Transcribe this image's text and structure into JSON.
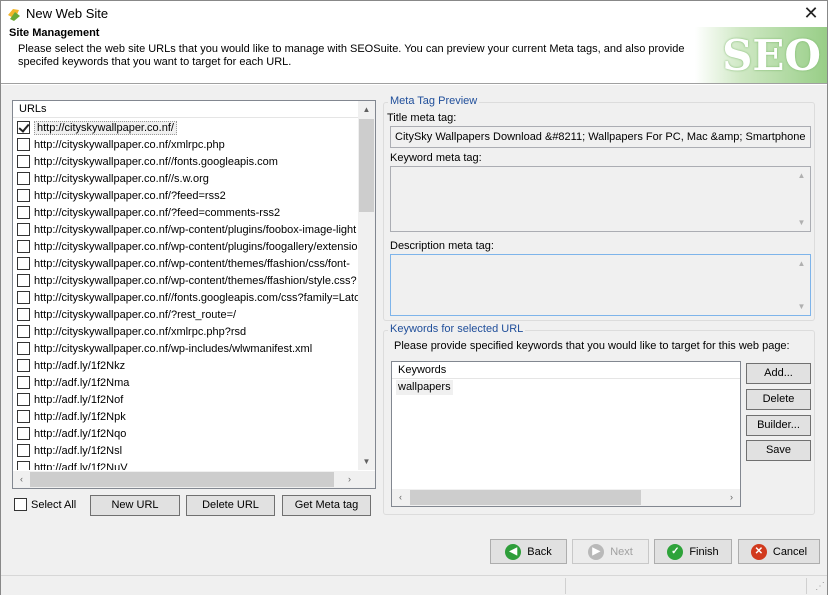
{
  "window": {
    "title": "New Web Site",
    "close_glyph": "✕"
  },
  "header": {
    "title": "Site Management",
    "description": "Please select the web site URLs that you would like to manage with SEOSuite. You can preview your current Meta tags, and also provide specifed keywords that you want to target for each URL.",
    "logo_text": "SEO"
  },
  "urls": {
    "column_header": "URLs",
    "items": [
      {
        "url": "http://cityskywallpaper.co.nf/",
        "checked": true
      },
      {
        "url": "http://cityskywallpaper.co.nf/xmlrpc.php",
        "checked": false
      },
      {
        "url": "http://cityskywallpaper.co.nf//fonts.googleapis.com",
        "checked": false
      },
      {
        "url": "http://cityskywallpaper.co.nf//s.w.org",
        "checked": false
      },
      {
        "url": "http://cityskywallpaper.co.nf/?feed=rss2",
        "checked": false
      },
      {
        "url": "http://cityskywallpaper.co.nf/?feed=comments-rss2",
        "checked": false
      },
      {
        "url": "http://cityskywallpaper.co.nf/wp-content/plugins/foobox-image-light",
        "checked": false
      },
      {
        "url": "http://cityskywallpaper.co.nf/wp-content/plugins/foogallery/extensio",
        "checked": false
      },
      {
        "url": "http://cityskywallpaper.co.nf/wp-content/themes/ffashion/css/font-",
        "checked": false
      },
      {
        "url": "http://cityskywallpaper.co.nf/wp-content/themes/ffashion/style.css?",
        "checked": false
      },
      {
        "url": "http://cityskywallpaper.co.nf//fonts.googleapis.com/css?family=Lato",
        "checked": false
      },
      {
        "url": "http://cityskywallpaper.co.nf/?rest_route=/",
        "checked": false
      },
      {
        "url": "http://cityskywallpaper.co.nf/xmlrpc.php?rsd",
        "checked": false
      },
      {
        "url": "http://cityskywallpaper.co.nf/wp-includes/wlwmanifest.xml",
        "checked": false
      },
      {
        "url": "http://adf.ly/1f2Nkz",
        "checked": false
      },
      {
        "url": "http://adf.ly/1f2Nma",
        "checked": false
      },
      {
        "url": "http://adf.ly/1f2Nof",
        "checked": false
      },
      {
        "url": "http://adf.ly/1f2Npk",
        "checked": false
      },
      {
        "url": "http://adf.ly/1f2Nqo",
        "checked": false
      },
      {
        "url": "http://adf.ly/1f2Nsl",
        "checked": false
      },
      {
        "url": "http://adf.ly/1f2NuV",
        "checked": false
      }
    ],
    "select_all_label": "Select All",
    "new_url_label": "New URL",
    "delete_url_label": "Delete URL",
    "get_meta_label": "Get Meta tag"
  },
  "meta_preview": {
    "group_title": "Meta Tag Preview",
    "title_label": "Title meta tag:",
    "title_value": "CitySky Wallpapers Download &#8211; Wallpapers For PC, Mac &amp; Smartphone",
    "keyword_label": "Keyword meta tag:",
    "keyword_value": "",
    "description_label": "Description meta tag:",
    "description_value": ""
  },
  "keywords": {
    "group_title": "Keywords for selected URL",
    "instructions": "Please provide specified keywords that you would like to target for this web page:",
    "column_header": "Keywords",
    "items": [
      "wallpapers"
    ],
    "add_label": "Add...",
    "delete_label": "Delete",
    "builder_label": "Builder...",
    "save_label": "Save"
  },
  "wizard": {
    "back_label": "Back",
    "next_label": "Next",
    "finish_label": "Finish",
    "cancel_label": "Cancel"
  },
  "colors": {
    "back_icon": "#2e9e3a",
    "next_icon": "#b9b9b9",
    "finish_icon": "#2ea33a",
    "cancel_icon": "#d13a1e",
    "group_title": "#1f4e9a",
    "logo_green": "#98ce87"
  },
  "icons": {
    "app": "site-logo-icon",
    "back": "arrow-left-icon",
    "next": "arrow-right-icon",
    "finish": "checkmark-icon",
    "cancel": "x-mark-icon"
  }
}
